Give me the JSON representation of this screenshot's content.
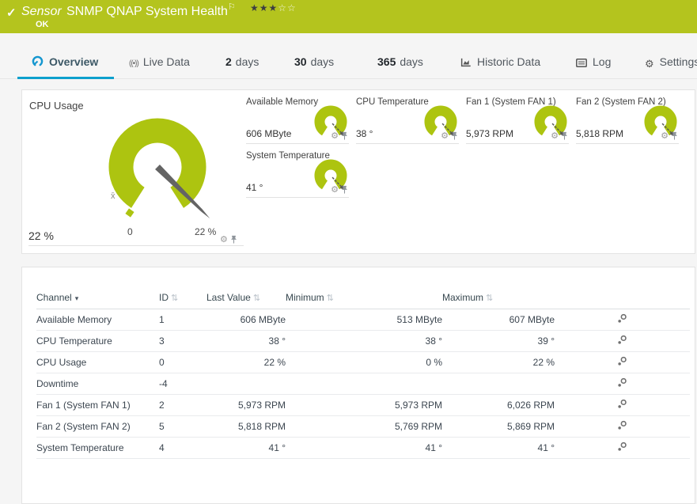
{
  "colors": {
    "status_ok_green": "#b4c41e",
    "gauge_green": "#adc410",
    "accent_blue": "#0da0cd"
  },
  "header": {
    "kind": "Sensor",
    "title": "SNMP QNAP System Health",
    "status": "OK",
    "rating_filled": "★★★",
    "rating_empty": "☆☆"
  },
  "icons": {
    "check": "✓",
    "flag": "⚐",
    "gear": "⚙",
    "settings_gear": "⚙",
    "live": "((•))",
    "sort_desc": "▾",
    "sort_both": "⇅"
  },
  "tabs": [
    {
      "key": "overview",
      "label": "Overview",
      "active": true
    },
    {
      "key": "live-data",
      "label": "Live Data"
    },
    {
      "key": "days-2",
      "num": "2",
      "label": "days"
    },
    {
      "key": "days-30",
      "num": "30",
      "label": "days"
    },
    {
      "key": "days-365",
      "num": "365",
      "label": "days"
    },
    {
      "key": "historic-data",
      "label": "Historic Data"
    },
    {
      "key": "log",
      "label": "Log"
    },
    {
      "key": "settings",
      "label": "Settings"
    }
  ],
  "gauges": {
    "primary": {
      "title": "CPU Usage",
      "value": "22 %",
      "scale_start": "0",
      "scale_end": "22 %",
      "mean_label": "x̄"
    },
    "small": [
      {
        "title": "Available Memory",
        "value": "606 MByte"
      },
      {
        "title": "CPU Temperature",
        "value": "38 °"
      },
      {
        "title": "Fan 1 (System FAN 1)",
        "value": "5,973 RPM"
      },
      {
        "title": "Fan 2 (System FAN 2)",
        "value": "5,818 RPM"
      },
      {
        "title": "System Temperature",
        "value": "41 °"
      }
    ]
  },
  "table": {
    "headers": {
      "channel": "Channel",
      "id": "ID",
      "last": "Last Value",
      "min": "Minimum",
      "max": "Maximum"
    },
    "rows": [
      {
        "channel": "Available Memory",
        "id": "1",
        "last": "606 MByte",
        "min": "513 MByte",
        "max": "607 MByte"
      },
      {
        "channel": "CPU Temperature",
        "id": "3",
        "last": "38 °",
        "min": "38 °",
        "max": "39 °"
      },
      {
        "channel": "CPU Usage",
        "id": "0",
        "last": "22 %",
        "min": "0 %",
        "max": "22 %"
      },
      {
        "channel": "Downtime",
        "id": "-4",
        "last": "",
        "min": "",
        "max": ""
      },
      {
        "channel": "Fan 1 (System FAN 1)",
        "id": "2",
        "last": "5,973 RPM",
        "min": "5,973 RPM",
        "max": "6,026 RPM"
      },
      {
        "channel": "Fan 2 (System FAN 2)",
        "id": "5",
        "last": "5,818 RPM",
        "min": "5,769 RPM",
        "max": "5,869 RPM"
      },
      {
        "channel": "System Temperature",
        "id": "4",
        "last": "41 °",
        "min": "41 °",
        "max": "41 °"
      }
    ]
  }
}
